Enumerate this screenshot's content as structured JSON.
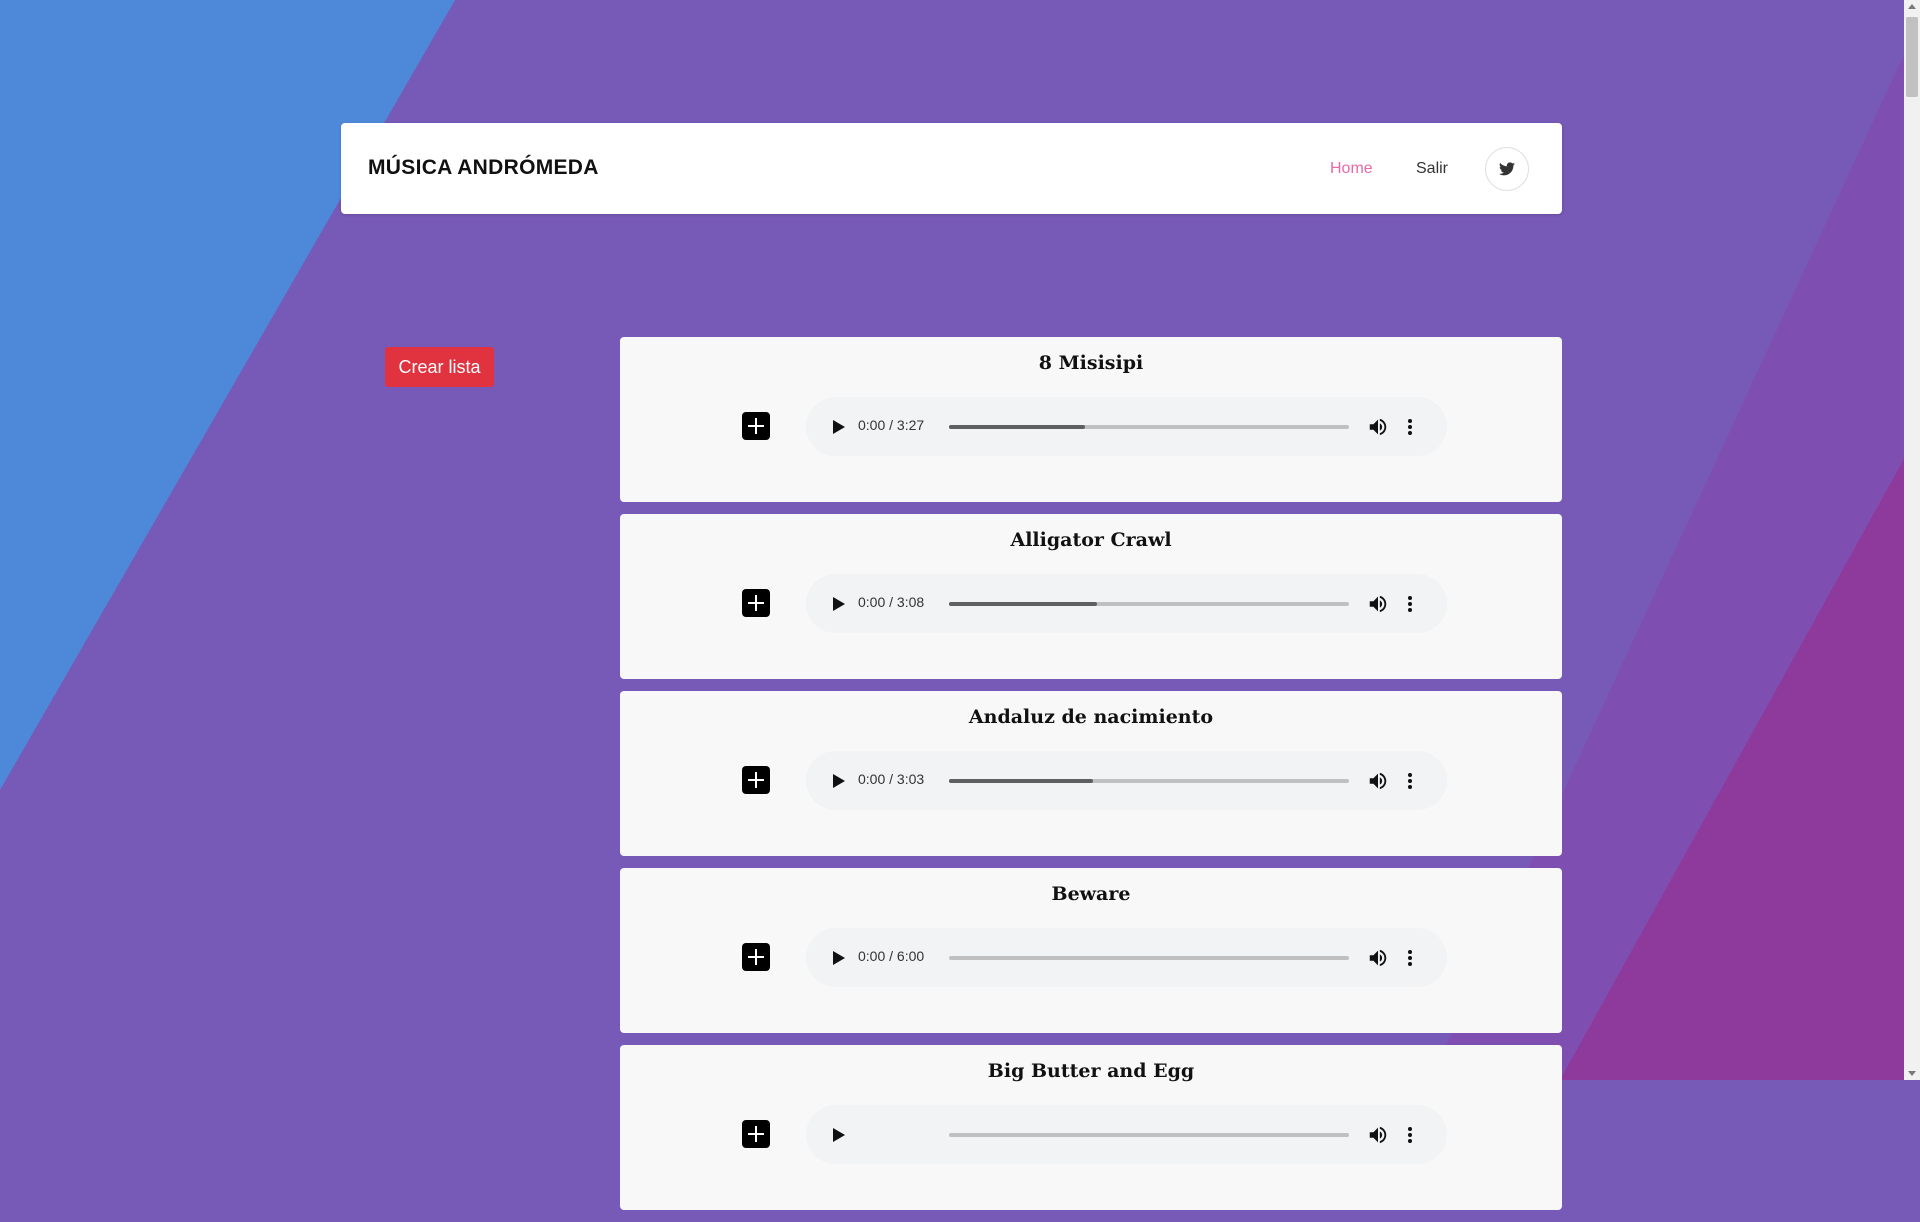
{
  "header": {
    "brand": "MÚSICA ANDRÓMEDA",
    "nav": {
      "home": "Home",
      "salir": "Salir"
    },
    "social_icon": "twitter-icon"
  },
  "sidebar": {
    "crear_lista": "Crear lista"
  },
  "songs": [
    {
      "title": "8 Misisipi",
      "time": "0:00 / 3:27",
      "buffered": 0.34
    },
    {
      "title": "Alligator Crawl",
      "time": "0:00 / 3:08",
      "buffered": 0.37
    },
    {
      "title": "Andaluz de nacimiento",
      "time": "0:00 / 3:03",
      "buffered": 0.36
    },
    {
      "title": "Beware",
      "time": "0:00 / 6:00",
      "buffered": 0
    },
    {
      "title": "Big Butter and Egg",
      "time": "",
      "buffered": 0
    }
  ],
  "colors": {
    "accent_home": "#e86aa6",
    "crear_button": "#e0323f",
    "bg_blue": "#4e89d9",
    "bg_purple": "#7759b7",
    "bg_magenta": "#8e3a9c"
  }
}
